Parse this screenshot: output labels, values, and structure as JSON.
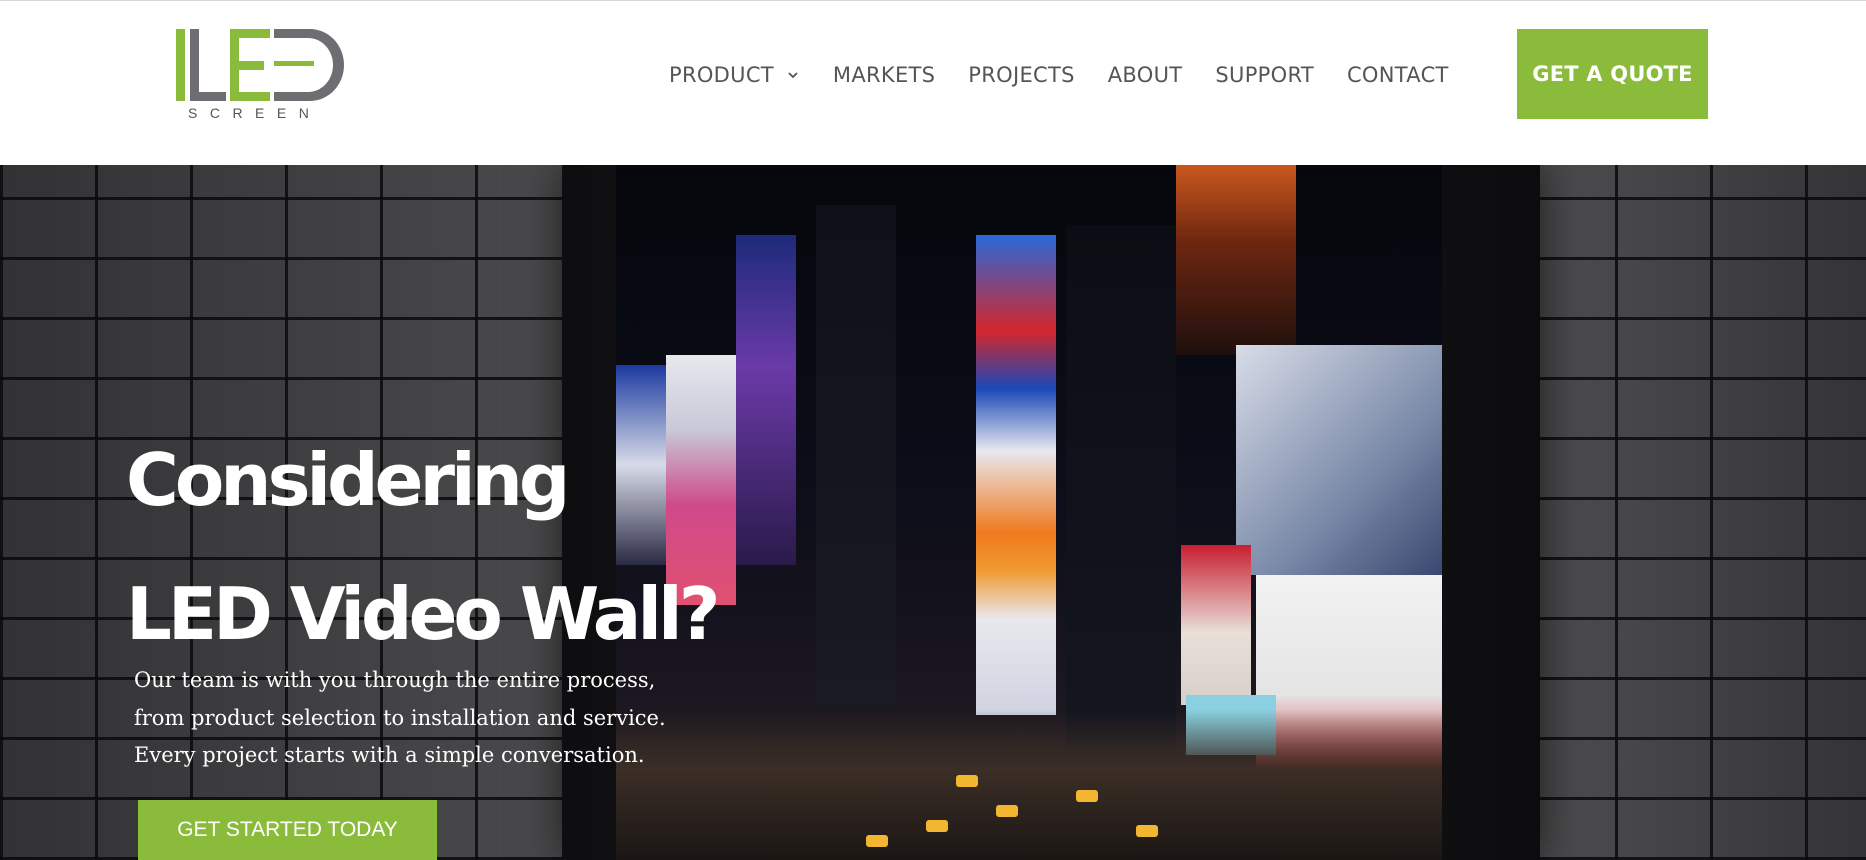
{
  "logo": {
    "letters": "LED",
    "sub": "SCREEN",
    "colors": {
      "green": "#8bbb3a",
      "gray": "#6d6e71"
    }
  },
  "nav": {
    "items": [
      {
        "label": "PRODUCT",
        "has_dropdown": true
      },
      {
        "label": "MARKETS"
      },
      {
        "label": "PROJECTS"
      },
      {
        "label": "ABOUT"
      },
      {
        "label": "SUPPORT"
      },
      {
        "label": "CONTACT"
      }
    ],
    "quote_button": "GET A QUOTE"
  },
  "hero": {
    "title_line1": "Considering",
    "title_line2": "LED Video Wall?",
    "sub_line1": "Our team is with you through the entire process,",
    "sub_line2": "from product selection to installation and service.",
    "sub_line3": "Every project starts with a simple conversation.",
    "cta": "GET STARTED TODAY"
  },
  "colors": {
    "accent": "#8bbb3a",
    "nav_text": "#555555",
    "hero_text": "#ffffff"
  },
  "icons": {
    "dropdown": "chevron-down-icon"
  }
}
